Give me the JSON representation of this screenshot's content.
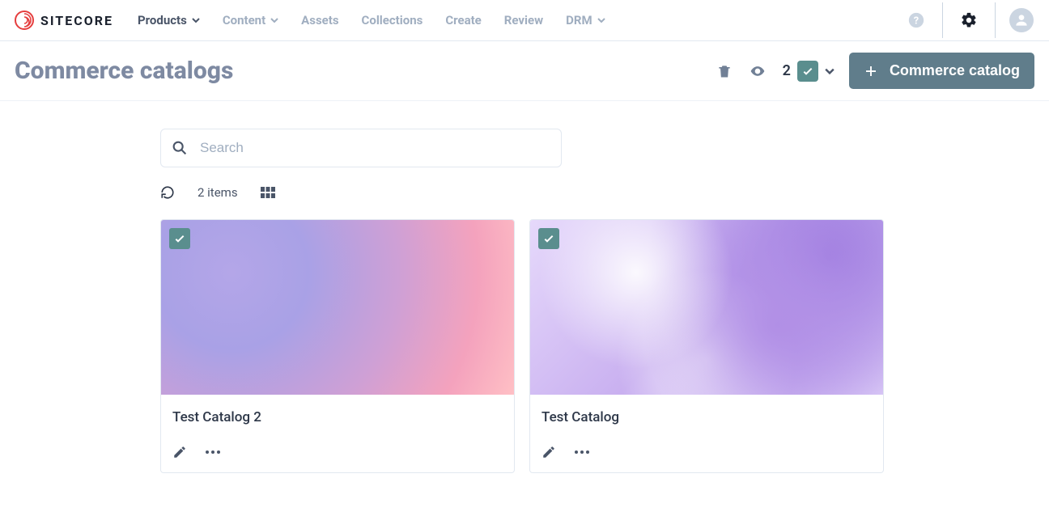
{
  "brand": {
    "name": "SITECORE"
  },
  "nav": {
    "items": [
      {
        "label": "Products",
        "dropdown": true,
        "active": true
      },
      {
        "label": "Content",
        "dropdown": true,
        "active": false
      },
      {
        "label": "Assets",
        "dropdown": false,
        "active": false
      },
      {
        "label": "Collections",
        "dropdown": false,
        "active": false
      },
      {
        "label": "Create",
        "dropdown": false,
        "active": false
      },
      {
        "label": "Review",
        "dropdown": false,
        "active": false
      },
      {
        "label": "DRM",
        "dropdown": true,
        "active": false
      }
    ]
  },
  "page": {
    "title": "Commerce catalogs"
  },
  "actions": {
    "selected_count": "2",
    "primary_label": "Commerce catalog"
  },
  "search": {
    "placeholder": "Search",
    "value": ""
  },
  "list": {
    "count_label": "2 items"
  },
  "cards": [
    {
      "title": "Test Catalog 2",
      "selected": true,
      "bg": "grad1"
    },
    {
      "title": "Test Catalog",
      "selected": true,
      "bg": "grad2"
    }
  ]
}
